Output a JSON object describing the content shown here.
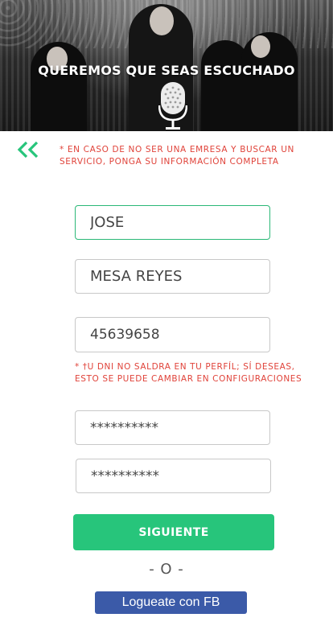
{
  "header": {
    "title": "QUEREMOS QUE SEAS ESCUCHADO"
  },
  "notice": {
    "text": "* EN CASO DE NO SER UNA EMRESA Y BUSCAR UN SERVICIO, PONGA SU INFORMACIÓN COMPLETA"
  },
  "form": {
    "first_name": "JOSE",
    "last_name": "MESA REYES",
    "dni": "45639658",
    "dni_note": "* †U DNI NO SALDRA EN TU PERFÍL; SÍ DESEAS, ESTO SE PUEDE CAMBIAR EN CONFIGURACIONES",
    "password": "**********",
    "password_confirm": "**********"
  },
  "actions": {
    "next_label": "SIGUIENTE",
    "or_label": "- O -",
    "facebook_label": "Logueate con FB"
  },
  "colors": {
    "accent": "#27c57b",
    "warning": "#e0433a",
    "facebook": "#3b5aa8"
  },
  "icons": {
    "back": "double-chevron-left-icon",
    "mic": "microphone-icon"
  }
}
